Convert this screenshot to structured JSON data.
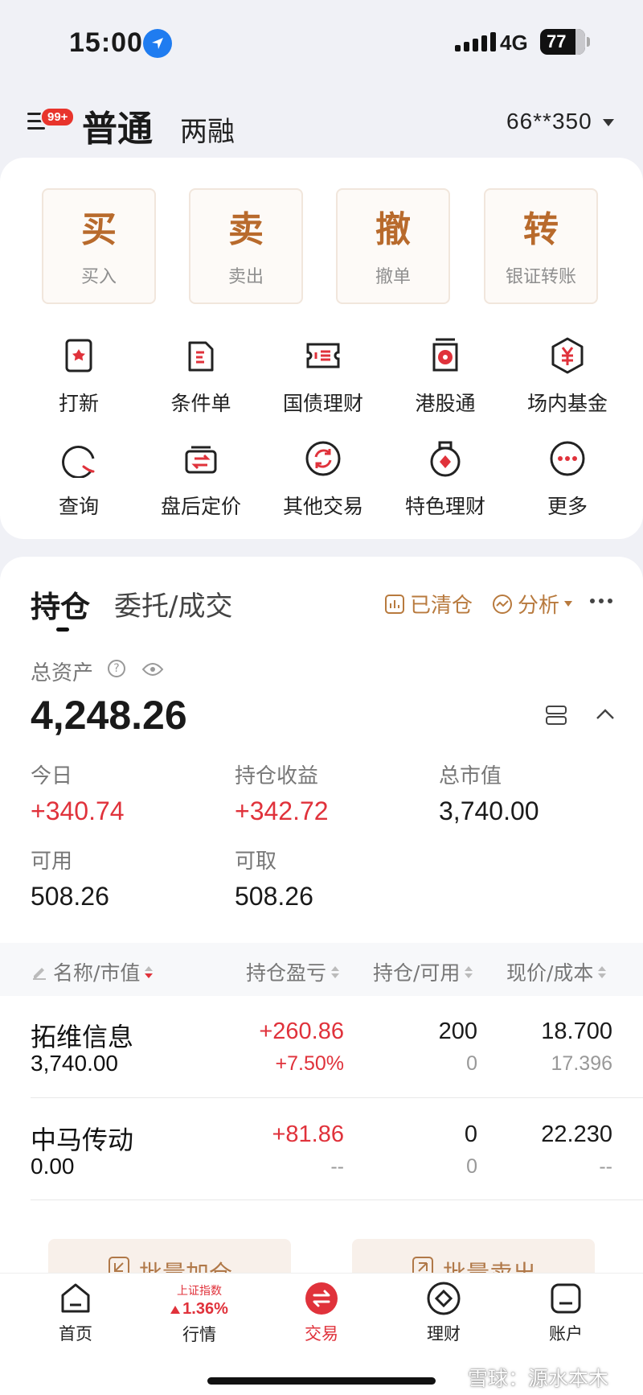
{
  "status_bar": {
    "time": "15:00",
    "network": "4G",
    "battery": "77"
  },
  "header": {
    "badge": "99+",
    "mode_active": "普通",
    "mode_other": "两融",
    "account": "66**350"
  },
  "quick_actions": [
    {
      "char": "买",
      "label": "买入"
    },
    {
      "char": "卖",
      "label": "卖出"
    },
    {
      "char": "撤",
      "label": "撤单"
    },
    {
      "char": "转",
      "label": "银证转账"
    }
  ],
  "services": [
    {
      "label": "打新",
      "icon": "ipo-icon"
    },
    {
      "label": "条件单",
      "icon": "condition-order-icon"
    },
    {
      "label": "国债理财",
      "icon": "bond-icon"
    },
    {
      "label": "港股通",
      "icon": "hk-connect-icon"
    },
    {
      "label": "场内基金",
      "icon": "fund-icon"
    },
    {
      "label": "查询",
      "icon": "query-icon"
    },
    {
      "label": "盘后定价",
      "icon": "after-hours-icon"
    },
    {
      "label": "其他交易",
      "icon": "other-trade-icon"
    },
    {
      "label": "特色理财",
      "icon": "featured-wealth-icon"
    },
    {
      "label": "更多",
      "icon": "more-icon"
    }
  ],
  "holdings": {
    "tab_active": "持仓",
    "tab_other": "委托/成交",
    "cleared_label": "已清仓",
    "analysis_label": "分析",
    "total_assets_label": "总资产",
    "total_assets": "4,248.26",
    "today_label": "今日",
    "today_value": "+340.74",
    "position_profit_label": "持仓收益",
    "position_profit_value": "+342.72",
    "market_value_label": "总市值",
    "market_value": "3,740.00",
    "available_label": "可用",
    "available_value": "508.26",
    "withdrawable_label": "可取",
    "withdrawable_value": "508.26"
  },
  "table": {
    "columns": [
      "名称/市值",
      "持仓盈亏",
      "持仓/可用",
      "现价/成本"
    ],
    "rows": [
      {
        "name": "拓维信息",
        "market_value": "3,740.00",
        "pnl": "+260.86",
        "pnl_pct": "+7.50%",
        "position": "200",
        "available": "0",
        "price": "18.700",
        "cost": "17.396"
      },
      {
        "name": "中马传动",
        "market_value": "0.00",
        "pnl": "+81.86",
        "pnl_pct": "--",
        "position": "0",
        "available": "0",
        "price": "22.230",
        "cost": "--"
      }
    ]
  },
  "batch": {
    "add": "批量加仓",
    "sell": "批量卖出"
  },
  "bottom_nav": {
    "home": "首页",
    "market_index_name": "上证指数",
    "market_index_value": "1.36%",
    "market": "行情",
    "trade": "交易",
    "wealth": "理财",
    "account": "账户"
  },
  "watermark": "雪球：源水本木",
  "colors": {
    "accent_red": "#e0323b",
    "brand_gold": "#b86a2c"
  }
}
